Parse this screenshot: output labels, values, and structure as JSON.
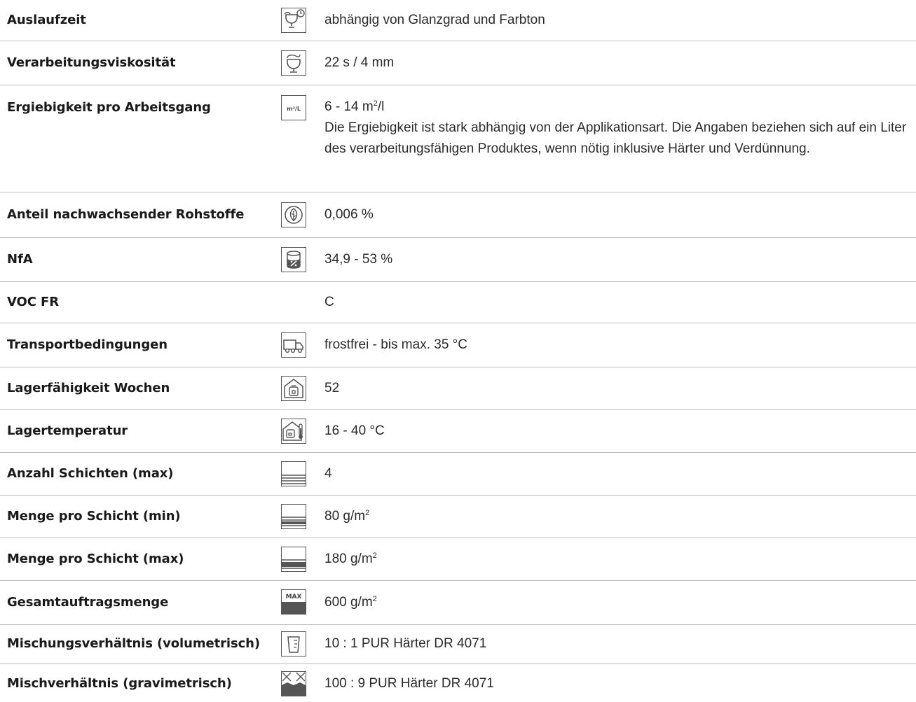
{
  "rows": [
    {
      "label": "Auslaufzeit",
      "icon": "flow-cup-clock-icon",
      "value": "abhängig von Glanzgrad und Farbton"
    },
    {
      "label": "Verarbeitungsviskosität",
      "icon": "flow-cup-icon",
      "value": "22 s / 4 mm"
    },
    {
      "label": "Ergiebigkeit pro Arbeitsgang",
      "icon": "coverage-m2-per-l-icon",
      "icon_text": "m²/L",
      "value": "6 - 14 m",
      "value_sup": "2",
      "value_suffix": "/l",
      "note": "Die Ergiebigkeit ist stark abhängig von der Applikationsart. Die Angaben beziehen sich auf ein Liter des verarbeitungsfähigen Produktes, wenn nötig inklusive Härter und Verdünnung."
    },
    {
      "label": "Anteil nachwachsender Rohstoffe",
      "icon": "leaf-icon",
      "value": "0,006 %"
    },
    {
      "label": "NfA",
      "icon": "solids-can-icon",
      "value": "34,9 - 53 %"
    },
    {
      "label": "VOC FR",
      "icon": "",
      "value": "C"
    },
    {
      "label": "Transportbedingungen",
      "icon": "truck-icon",
      "value": "frostfrei - bis max. 35 °C"
    },
    {
      "label": "Lagerfähigkeit Wochen",
      "icon": "storage-house-icon",
      "value": "52"
    },
    {
      "label": "Lagertemperatur",
      "icon": "storage-thermometer-icon",
      "value": "16 - 40 °C"
    },
    {
      "label": "Anzahl Schichten (max)",
      "icon": "layers-icon",
      "value": "4"
    },
    {
      "label": "Menge pro Schicht (min)",
      "icon": "layer-amount-min-icon",
      "value": "80 g/m",
      "value_sup": "2",
      "value_suffix": ""
    },
    {
      "label": "Menge pro Schicht (max)",
      "icon": "layer-amount-max-icon",
      "value": "180 g/m",
      "value_sup": "2",
      "value_suffix": ""
    },
    {
      "label": "Gesamtauftragsmenge",
      "icon": "max-total-icon",
      "icon_text": "MAX",
      "value": "600 g/m",
      "value_sup": "2",
      "value_suffix": ""
    },
    {
      "label": "Mischungsverhältnis (volumetrisch)",
      "icon": "measuring-cup-icon",
      "value": "10 : 1 PUR Härter DR 4071"
    },
    {
      "label": "Mischverhältnis (gravimetrisch)",
      "icon": "scale-mix-icon",
      "value": "100 : 9 PUR Härter DR 4071"
    }
  ]
}
